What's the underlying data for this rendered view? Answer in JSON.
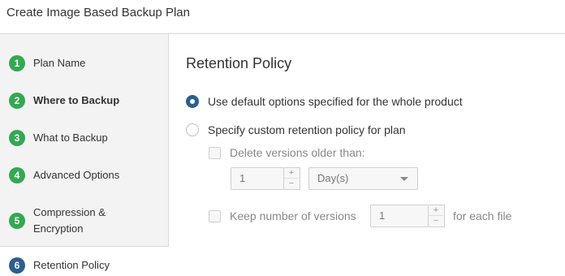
{
  "window": {
    "title": "Create Image Based Backup Plan"
  },
  "sidebar": {
    "steps": [
      {
        "number": "1",
        "label": "Plan Name"
      },
      {
        "number": "2",
        "label": "Where to Backup"
      },
      {
        "number": "3",
        "label": "What to Backup"
      },
      {
        "number": "4",
        "label": "Advanced Options"
      },
      {
        "number": "5",
        "label_line1": "Compression &",
        "label_line2": "Encryption"
      },
      {
        "number": "6",
        "label": "Retention Policy"
      }
    ]
  },
  "main": {
    "title": "Retention Policy",
    "option_default": {
      "label": "Use default options specified for the whole product",
      "checked": true
    },
    "option_custom": {
      "label": "Specify custom retention policy for plan",
      "checked": false
    },
    "delete_versions": {
      "label": "Delete versions older than:",
      "checked": false,
      "value": "1",
      "unit": "Day(s)"
    },
    "keep_versions": {
      "label": "Keep number of versions",
      "checked": false,
      "value": "1",
      "suffix": "for each file"
    },
    "stepper_up": "+",
    "stepper_down": "−"
  },
  "colors": {
    "step_done": "#34a853",
    "step_active": "#2c5f8f",
    "accent": "#2c5f8f"
  }
}
